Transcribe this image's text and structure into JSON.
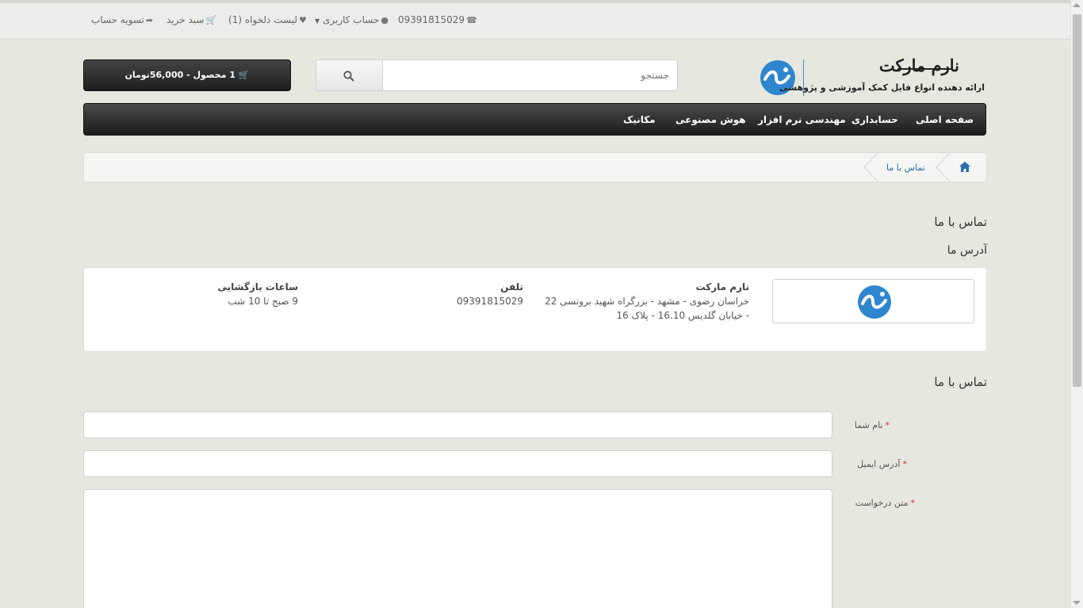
{
  "top_bar": {
    "phone": "09391815029",
    "account": "حساب کاربری",
    "wishlist": "لیست دلخواه (1)",
    "cart": "سبد خرید",
    "checkout": "تسویه حساب"
  },
  "header": {
    "logo_title": "نارم مارکت",
    "logo_subtitle": "ارائه دهنده انواع فایل کمک آموزشی و پژوهشی",
    "search_placeholder": "جستجو",
    "cart_button": "1 محصول - 56,000تومان"
  },
  "nav": {
    "items": [
      "صفحه اصلی",
      "حسابداری",
      "مهندسی نرم افزار",
      "هوش مصنوعی",
      "مکانیک"
    ]
  },
  "breadcrumb": {
    "current": "تماس با ما"
  },
  "page": {
    "title": "تماس با ما",
    "address_heading": "آدرس ما",
    "form_heading": "تماس با ما"
  },
  "info": {
    "store_name": "نارم مارکت",
    "address_line1": "خراسان رضوی - مشهد - بزرگراه شهید برونسی 22",
    "address_line2": "- خیابان گلدیس 16.10 - پلاک 16",
    "phone_title": "تلفن",
    "phone_value": "09391815029",
    "hours_title": "ساعات بازگشایی",
    "hours_value": "9 صبح تا 10 شب"
  },
  "form": {
    "name_label": "نام شما",
    "email_label": "آدرس ایمیل",
    "message_label": "متن درخواست"
  },
  "colors": {
    "accent": "#2a6fb0",
    "logo_blue": "#2e86cf",
    "required": "#c0392b"
  }
}
